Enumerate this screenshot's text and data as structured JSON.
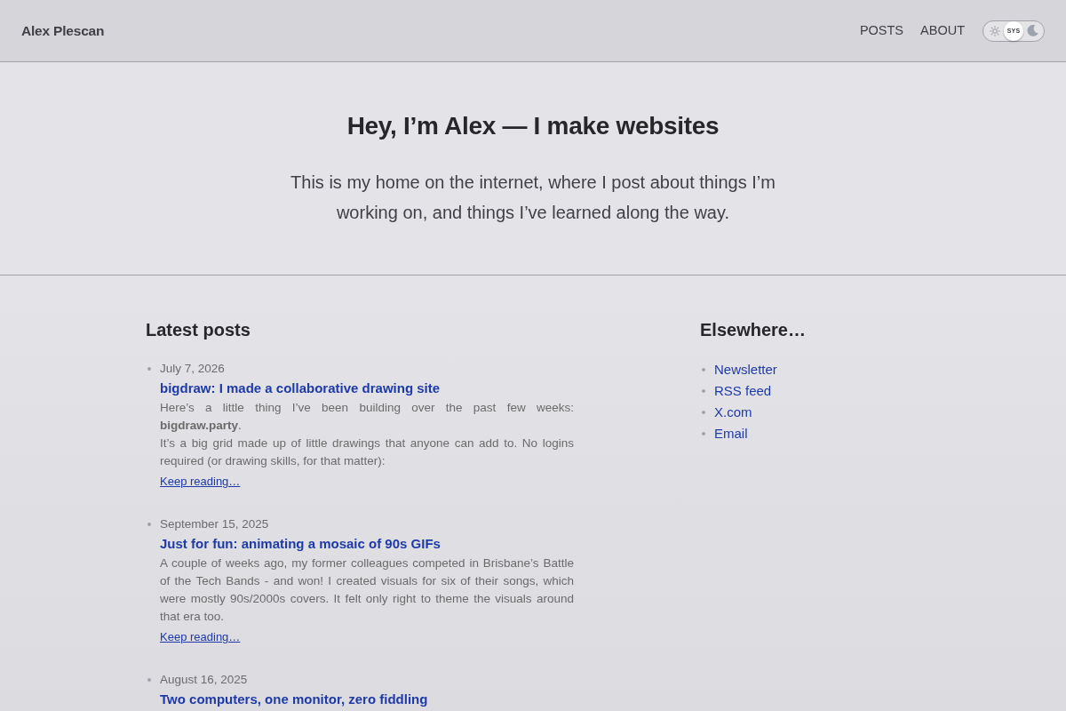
{
  "header": {
    "site_title": "Alex Plescan",
    "nav": [
      "POSTS",
      "ABOUT"
    ],
    "theme_switch": [
      {
        "kind": "light",
        "selected": false
      },
      {
        "kind": "system",
        "label": "SYS",
        "selected": true
      },
      {
        "kind": "dark",
        "selected": false
      }
    ]
  },
  "hero": {
    "heading": "Hey, I’m Alex — I make websites",
    "text": "This is my home on the internet, where I post about things I’m working on, and things I’ve learned along the way."
  },
  "latest_posts": {
    "heading": "Latest posts",
    "posts": [
      {
        "date": "July 7, 2026",
        "title": "bigdraw: I made a collaborative drawing site",
        "excerpt": [
          "Here’s a little thing I’ve been building over the past few weeks: **bigdraw.party**.",
          "It’s a big grid made up of little drawings that anyone can add to. No logins required (or drawing skills, for that matter):"
        ],
        "more": "Keep reading…"
      },
      {
        "date": "September 15, 2025",
        "title": "Just for fun: animating a mosaic of 90s GIFs",
        "excerpt": [
          "A couple of weeks ago, my former colleagues competed in Brisbane’s Battle of the Tech Bands - and won! I created visuals for six of their songs, which were mostly 90s/2000s covers. It felt only right to theme the visuals around that era too."
        ],
        "more": "Keep reading…"
      },
      {
        "date": "August 16, 2025",
        "title": "Two computers, one monitor, zero fiddling"
      }
    ]
  },
  "elsewhere": {
    "heading": "Elsewhere…",
    "links": [
      "Newsletter",
      "RSS feed",
      "X.com",
      "Email"
    ]
  }
}
